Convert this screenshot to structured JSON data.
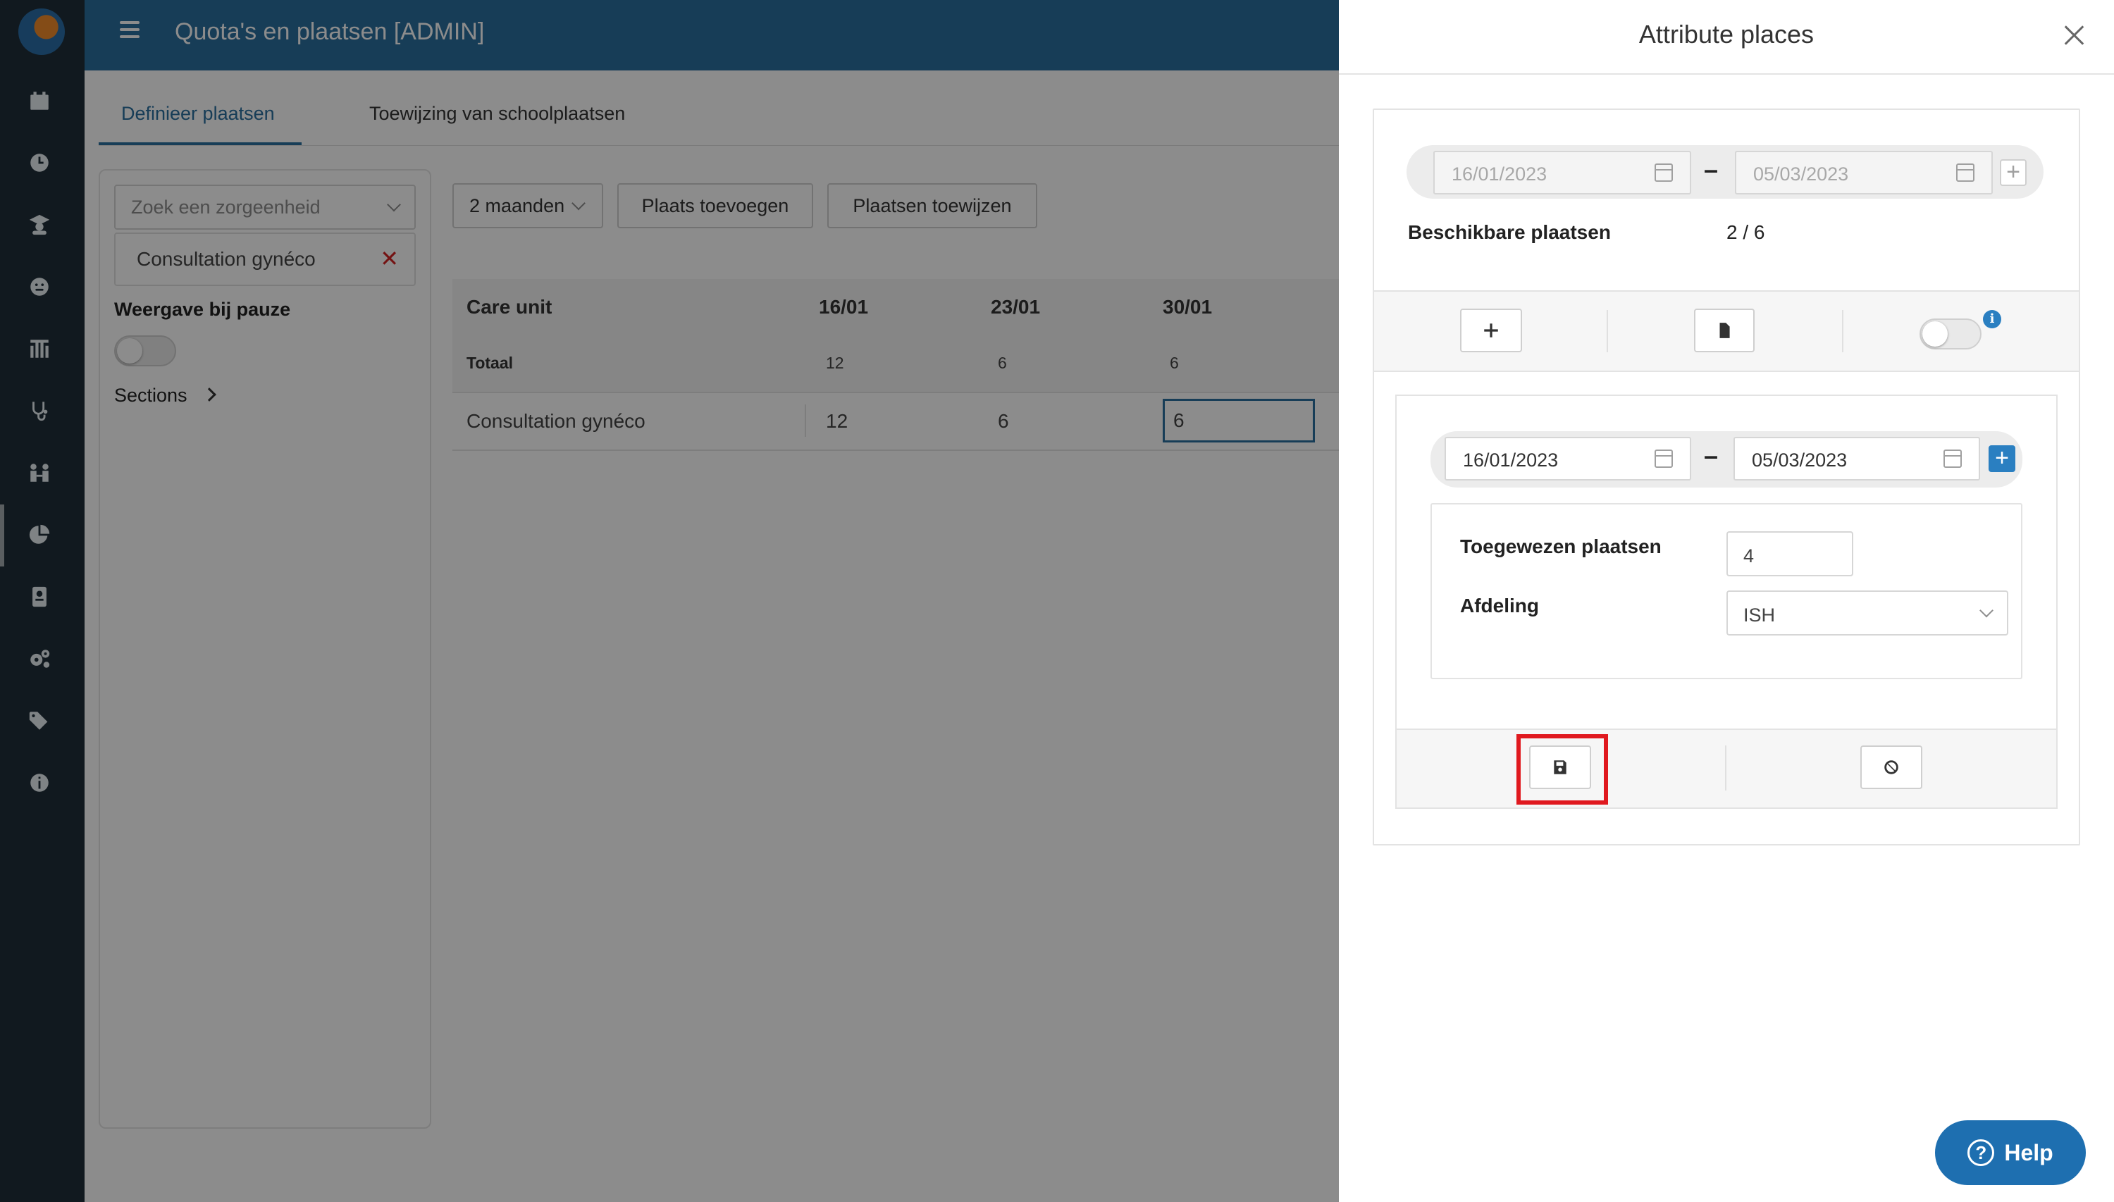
{
  "app": {
    "title": "Quota's en plaatsen [ADMIN]"
  },
  "sidebar": {
    "icons": [
      "calendar-icon",
      "clock-icon",
      "student-icon",
      "smiley-icon",
      "classroom-icon",
      "stethoscope-icon",
      "people-icon",
      "pie-chart-icon",
      "badge-icon",
      "cogs-icon",
      "tags-icon",
      "info-icon"
    ],
    "active": "pie-chart-icon"
  },
  "tabs": [
    {
      "label": "Definieer plaatsen",
      "active": true
    },
    {
      "label": "Toewijzing van schoolplaatsen",
      "active": false
    }
  ],
  "filters": {
    "search_placeholder": "Zoek een zorgeenheid",
    "selected_unit": "Consultation gynéco",
    "pause_label": "Weergave bij pauze",
    "sections_label": "Sections"
  },
  "toolbar": {
    "period": "2 maanden",
    "add_place": "Plaats toevoegen",
    "assign_places": "Plaatsen toewijzen"
  },
  "table": {
    "columns": [
      "Care unit",
      "16/01",
      "23/01",
      "30/01"
    ],
    "total_row": {
      "label": "Totaal",
      "values": [
        "12",
        "6",
        "6"
      ]
    },
    "rows": [
      {
        "label": "Consultation gynéco",
        "values": [
          "12",
          "6",
          "6"
        ]
      }
    ]
  },
  "drawer": {
    "title": "Attribute places",
    "top_range": {
      "start": "16/01/2023",
      "end": "05/03/2023"
    },
    "available_label": "Beschikbare plaatsen",
    "available_value": "2 / 6",
    "form": {
      "range": {
        "start": "16/01/2023",
        "end": "05/03/2023"
      },
      "assigned_label": "Toegewezen plaatsen",
      "assigned_value": "4",
      "department_label": "Afdeling",
      "department_value": "ISH"
    }
  },
  "help": {
    "label": "Help"
  },
  "colors": {
    "primary": "#2a6f9e",
    "sidebar": "#1f2f39",
    "highlight": "#e0191f"
  }
}
